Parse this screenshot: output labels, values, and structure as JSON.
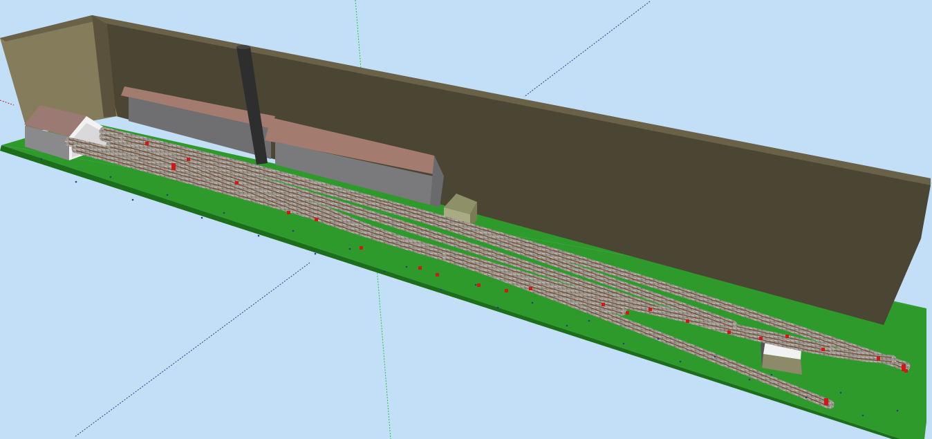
{
  "scene": {
    "kind": "3d-model-railway-layout",
    "colors": {
      "sky": "#c2dff7",
      "baseboard_top": "#2f9a2c",
      "baseboard_edge": "#1c6f1a",
      "backdrop_wall": "#4b4533",
      "backdrop_wall_lit": "#5a523c",
      "side_wall": "#857c5c",
      "wall_top": "#6a6248",
      "ballast": "#9a938c",
      "rail": "#6e4a30",
      "buffer_red": "#d01818",
      "chimney": "#2e2e2e",
      "warehouse_wall": "#7a7a7c",
      "warehouse_roof": "#a37b6f",
      "shed_wall": "#8a8a8c",
      "shed_roof": "#9c7a74",
      "small_house": "#9ea07a",
      "hut_roof": "#f2f2f2",
      "hut_wall": "#8c8a68",
      "axis_green": "#27c13a",
      "axis_blue": "#2b3b8a",
      "axis_red": "#b02020"
    },
    "objects": [
      {
        "name": "backdrop-wall",
        "count": 1
      },
      {
        "name": "side-wall",
        "count": 1
      },
      {
        "name": "chimney",
        "count": 1
      },
      {
        "name": "warehouse",
        "count": 2
      },
      {
        "name": "engine-shed",
        "count": 1
      },
      {
        "name": "signal-box",
        "count": 1
      },
      {
        "name": "lineside-hut",
        "count": 1
      },
      {
        "name": "track",
        "count": 7
      },
      {
        "name": "buffer-stop",
        "count": 3
      }
    ]
  }
}
